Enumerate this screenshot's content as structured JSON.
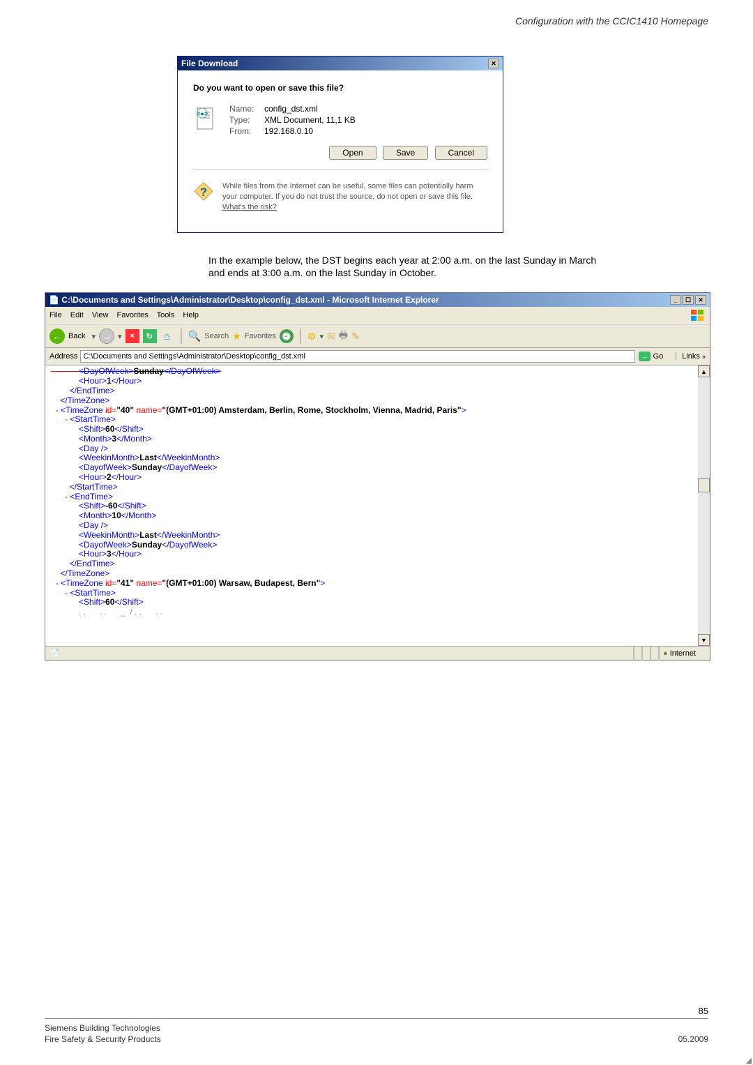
{
  "header": {
    "title": "Configuration with the CCIC1410 Homepage"
  },
  "file_dialog": {
    "title": "File Download",
    "question": "Do you want to open or save this file?",
    "name_label": "Name:",
    "name_value": "config_dst.xml",
    "type_label": "Type:",
    "type_value": "XML Document, 11,1 KB",
    "from_label": "From:",
    "from_value": "192.168.0.10",
    "open_btn": "Open",
    "save_btn": "Save",
    "cancel_btn": "Cancel",
    "warning": "While files from the Internet can be useful, some files can potentially harm your computer. If you do not trust the source, do not open or save this file. ",
    "risk_link": "What's the risk?"
  },
  "explain_text": "In the example below, the DST begins each year at 2:00 a.m. on the last Sunday in March and ends at 3:00 a.m. on the last Sunday in October.",
  "ie": {
    "title": "C:\\Documents and Settings\\Administrator\\Desktop\\config_dst.xml - Microsoft Internet Explorer",
    "menu": [
      "File",
      "Edit",
      "View",
      "Favorites",
      "Tools",
      "Help"
    ],
    "back_label": "Back",
    "search_label": "Search",
    "favorites_label": "Favorites",
    "address_label": "Address",
    "address_value": "C:\\Documents and Settings\\Administrator\\Desktop\\config_dst.xml",
    "go_label": "Go",
    "links_label": "Links",
    "xml": {
      "top_cut": "<DayOfWeek>Sunday</DayOfWeek>",
      "hour1": "1",
      "tz40_attrs": {
        "id": "\"40\"",
        "name": "\"(GMT+01:00) Amsterdam, Berlin, Rome, Stockholm, Vienna, Madrid, Paris\""
      },
      "start40": {
        "shift": "60",
        "month": "3",
        "week": "Last",
        "dow": "Sunday",
        "hour": "2"
      },
      "end40": {
        "shift": "-60",
        "month": "10",
        "week": "Last",
        "dow": "Sunday",
        "hour": "3"
      },
      "tz41_attrs": {
        "id": "\"41\"",
        "name": "\"(GMT+01:00) Warsaw, Budapest, Bern\""
      },
      "start41": {
        "shift": "60"
      }
    },
    "status_zone": "Internet"
  },
  "footer": {
    "page_number": "85",
    "company": "Siemens Building Technologies",
    "product": "Fire Safety & Security Products",
    "date": "05.2009"
  }
}
